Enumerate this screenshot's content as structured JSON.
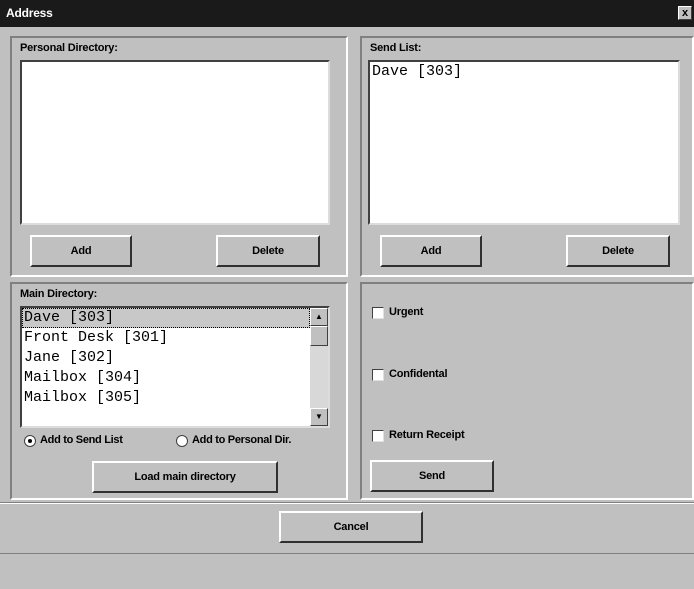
{
  "window": {
    "title": "Address",
    "close_glyph": "x"
  },
  "personal_directory": {
    "label": "Personal Directory:",
    "items": [],
    "add_label": "Add",
    "delete_label": "Delete"
  },
  "send_list": {
    "label": "Send List:",
    "items": [
      "Dave [303]"
    ],
    "add_label": "Add",
    "delete_label": "Delete"
  },
  "main_directory": {
    "label": "Main Directory:",
    "items": [
      "Dave [303]",
      "Front Desk [301]",
      "Jane [302]",
      "Mailbox [304]",
      "Mailbox [305]"
    ],
    "selected_index": 0,
    "radio_options": [
      {
        "label": "Add to Send List",
        "checked": true
      },
      {
        "label": "Add to Personal Dir.",
        "checked": false
      }
    ],
    "load_label": "Load main directory"
  },
  "options": {
    "urgent_label": "Urgent",
    "urgent_checked": false,
    "confidential_label": "Confidental",
    "confidential_checked": false,
    "return_receipt_label": "Return Receipt",
    "return_receipt_checked": false,
    "send_label": "Send"
  },
  "footer": {
    "cancel_label": "Cancel"
  },
  "icons": {
    "scroll_up": "scroll-up-arrow-icon",
    "scroll_down": "scroll-down-arrow-icon"
  }
}
